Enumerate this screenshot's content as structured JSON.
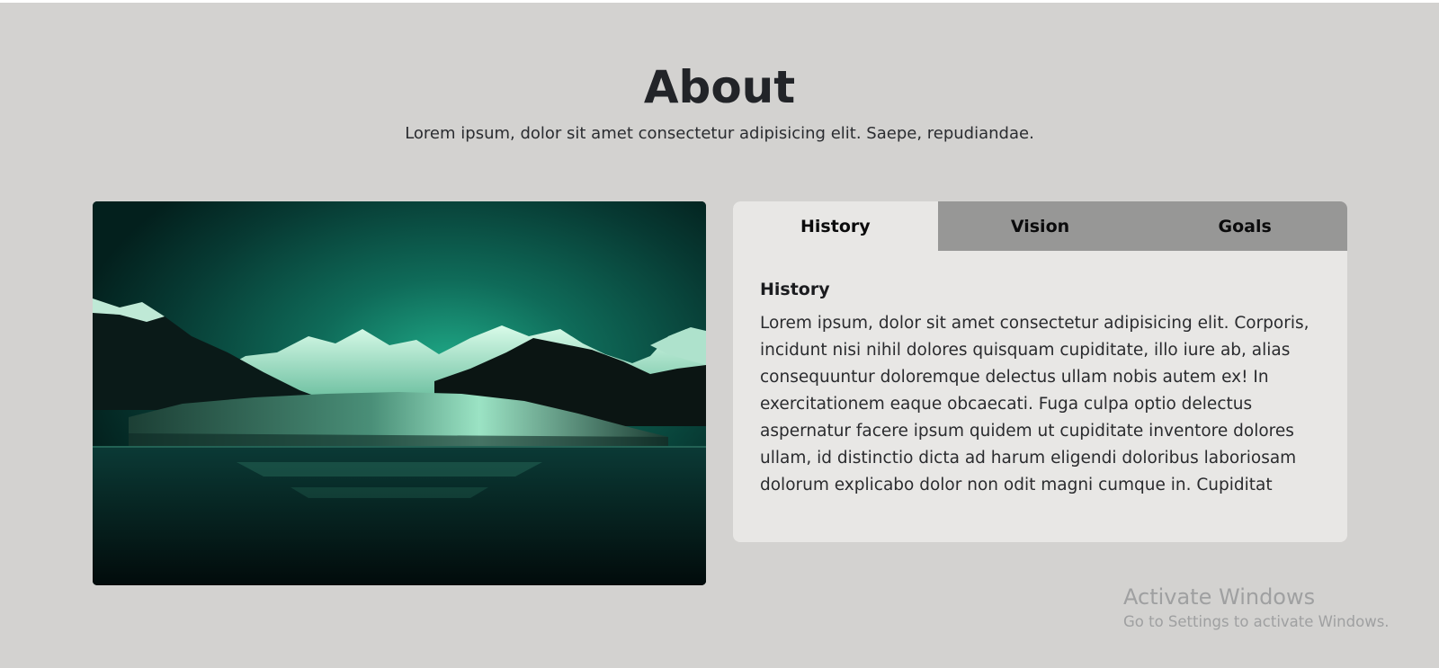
{
  "about": {
    "title": "About",
    "subtitle": "Lorem ipsum, dolor sit amet consectetur adipisicing elit. Saepe, repudiandae."
  },
  "tabs": [
    {
      "label": "History",
      "active": true
    },
    {
      "label": "Vision",
      "active": false
    },
    {
      "label": "Goals",
      "active": false
    }
  ],
  "content": {
    "heading": "History",
    "body": "Lorem ipsum, dolor sit amet consectetur adipisicing elit. Corporis, incidunt nisi nihil dolores quisquam cupiditate, illo iure ab, alias consequuntur doloremque delectus ullam nobis autem ex! In exercitationem eaque obcaecati. Fuga culpa optio delectus aspernatur facere ipsum quidem ut cupiditate inventore dolores ullam, id distinctio dicta ad harum eligendi doloribus laboriosam dolorum explicabo dolor non odit magni cumque in. Cupiditat"
  },
  "image": {
    "subject": "glacier-mountain-lake",
    "tint": "#1fa886"
  },
  "watermark": {
    "title": "Activate Windows",
    "subtitle": "Go to Settings to activate Windows."
  },
  "colors": {
    "background": "#d3d2d0",
    "panel": "#e8e7e5",
    "tab_inactive": "#979796"
  }
}
